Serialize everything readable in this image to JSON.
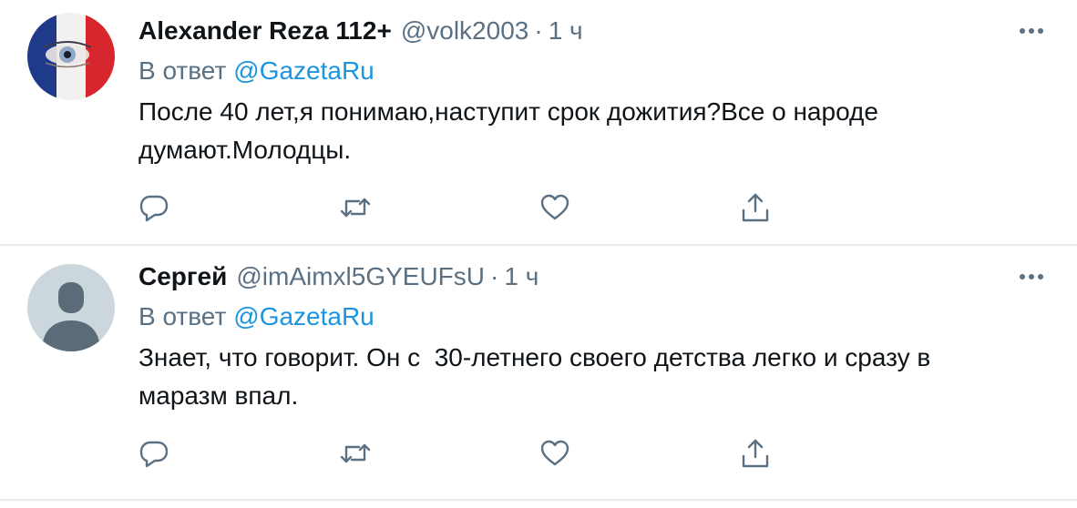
{
  "tweets": [
    {
      "display_name": "Alexander Reza 112+",
      "handle": "@volk2003",
      "separator": "·",
      "time": "1 ч",
      "reply_prefix": "В ответ",
      "reply_to": "@GazetaRu",
      "text": "После 40 лет,я понимаю,наступит срок дожития?Все о народе думают.Молодцы.",
      "avatar": "french-flag-eye-avatar",
      "more_icon": "more-icon",
      "actions": [
        "reply-icon",
        "retweet-icon",
        "like-icon",
        "share-icon"
      ]
    },
    {
      "display_name": "Сергей",
      "handle": "@imAimxl5GYEUFsU",
      "separator": "·",
      "time": "1 ч",
      "reply_prefix": "В ответ",
      "reply_to": "@GazetaRu",
      "text": "Знает, что говорит. Он с  30-летнего своего детства легко и сразу в маразм впал.",
      "avatar": "default-avatar",
      "more_icon": "more-icon",
      "actions": [
        "reply-icon",
        "retweet-icon",
        "like-icon",
        "share-icon"
      ]
    }
  ],
  "colors": {
    "text": "#0f1419",
    "secondary": "#5b7083",
    "link": "#1b95e0",
    "divider": "#e6ecf0"
  }
}
